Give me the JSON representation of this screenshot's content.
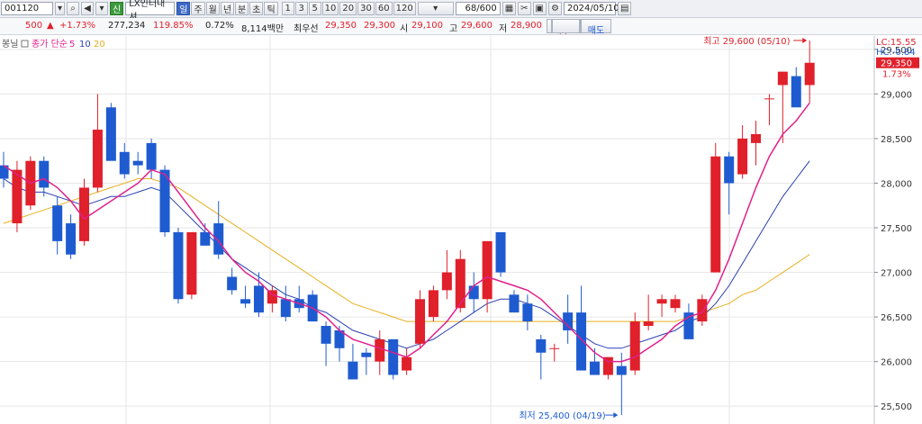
{
  "toolbar": {
    "code": "001120",
    "stock_name": "LX인터내셔",
    "period_tabs": [
      "일",
      "주",
      "월",
      "년",
      "분",
      "초",
      "틱"
    ],
    "active_tab": "일",
    "minute_options": [
      "1",
      "3",
      "5",
      "10",
      "20",
      "30",
      "60",
      "120"
    ],
    "count": "68",
    "count_total": "/600",
    "date": "2024/05/10",
    "badge": "신"
  },
  "info_bar": {
    "change": "500",
    "change_pct": "+1.73%",
    "volume": "277,234",
    "volume_ratio": "119.85%",
    "turnover": "0.72%",
    "amount": "8,114백만",
    "best_ask_label": "최우선",
    "best_ask": "29,350",
    "best_bid": "29,300",
    "open_label": "시",
    "open": "29,100",
    "high_label": "고",
    "high": "29,600",
    "low_label": "저",
    "low": "28,900",
    "buy_label": "매수",
    "sell_label": "매도"
  },
  "legend": {
    "prefix": "봉닐",
    "ma_label": "종가 단순",
    "ma_periods": [
      "5",
      "10",
      "20"
    ]
  },
  "colors": {
    "up": "#e0202a",
    "down": "#1f5bd0",
    "ma5": "#e0208c",
    "ma10": "#2a3fb0",
    "ma20": "#e8b020",
    "grid": "#e6e6e6"
  },
  "right_axis_labels": {
    "lc": "LC:15.55",
    "hc": "HC:-0.84",
    "last_price": "29,350",
    "last_pct": "1.73%"
  },
  "chart_data": {
    "type": "candlestick",
    "ylim": [
      25300,
      29650
    ],
    "y_ticks": [
      25500,
      26000,
      26500,
      27000,
      27500,
      28000,
      28500,
      29000,
      29500
    ],
    "y_tick_labels": [
      "25,500",
      "26,000",
      "26,500",
      "27,000",
      "27,500",
      "28,000",
      "28,500",
      "29,000",
      "29,500"
    ],
    "annotations": [
      {
        "text": "최고 29,600 (05/10)",
        "value": 29600
      },
      {
        "text": "최저 25,400 (04/19)",
        "value": 25400
      }
    ],
    "candles": [
      [
        28200,
        28350,
        27950,
        28050
      ],
      [
        27550,
        28250,
        27450,
        28150
      ],
      [
        27750,
        28300,
        27700,
        28250
      ],
      [
        28250,
        28300,
        27850,
        27950
      ],
      [
        27750,
        27850,
        27200,
        27350
      ],
      [
        27550,
        27650,
        27150,
        27200
      ],
      [
        27350,
        28050,
        27300,
        27950
      ],
      [
        27950,
        29000,
        27900,
        28600
      ],
      [
        28850,
        28900,
        28300,
        28250
      ],
      [
        28350,
        28450,
        28050,
        28100
      ],
      [
        28250,
        28350,
        28100,
        28200
      ],
      [
        28450,
        28500,
        28050,
        28150
      ],
      [
        28150,
        28200,
        27400,
        27450
      ],
      [
        27450,
        27500,
        26650,
        26700
      ],
      [
        26750,
        27450,
        26700,
        27450
      ],
      [
        27450,
        27550,
        27300,
        27300
      ],
      [
        27550,
        27800,
        27150,
        27200
      ],
      [
        26950,
        27050,
        26750,
        26800
      ],
      [
        26700,
        26850,
        26600,
        26650
      ],
      [
        26850,
        27000,
        26500,
        26550
      ],
      [
        26650,
        26850,
        26550,
        26800
      ],
      [
        26700,
        26850,
        26450,
        26500
      ],
      [
        26700,
        26850,
        26550,
        26600
      ],
      [
        26750,
        26800,
        26450,
        26450
      ],
      [
        26400,
        26450,
        25950,
        26200
      ],
      [
        26350,
        26400,
        26000,
        26150
      ],
      [
        26000,
        26200,
        25800,
        25800
      ],
      [
        26100,
        26150,
        25850,
        26050
      ],
      [
        26000,
        26350,
        25850,
        26250
      ],
      [
        26250,
        26250,
        25800,
        25850
      ],
      [
        25900,
        26150,
        25850,
        26050
      ],
      [
        26200,
        26800,
        26150,
        26700
      ],
      [
        26500,
        26850,
        26450,
        26800
      ],
      [
        26800,
        27250,
        26700,
        27000
      ],
      [
        26600,
        27250,
        26550,
        27150
      ],
      [
        26850,
        27000,
        26550,
        26700
      ],
      [
        26700,
        27350,
        26550,
        27350
      ],
      [
        27450,
        27450,
        26950,
        27000
      ],
      [
        26750,
        26800,
        26550,
        26550
      ],
      [
        26650,
        26750,
        26350,
        26450
      ],
      [
        26250,
        26300,
        25800,
        26100
      ],
      [
        26150,
        26200,
        26000,
        26150
      ],
      [
        26550,
        26750,
        26200,
        26350
      ],
      [
        26550,
        26850,
        25900,
        25900
      ],
      [
        26000,
        26150,
        25900,
        25850
      ],
      [
        25850,
        26050,
        25800,
        26050
      ],
      [
        25950,
        26100,
        25400,
        25850
      ],
      [
        25900,
        26550,
        25850,
        26450
      ],
      [
        26400,
        26750,
        26350,
        26450
      ],
      [
        26650,
        26750,
        26500,
        26700
      ],
      [
        26600,
        26750,
        26550,
        26700
      ],
      [
        26550,
        26650,
        26300,
        26250
      ],
      [
        26450,
        26750,
        26400,
        26700
      ],
      [
        27000,
        28450,
        27000,
        28300
      ],
      [
        28300,
        28350,
        27650,
        28000
      ],
      [
        28100,
        28650,
        28050,
        28500
      ],
      [
        28450,
        28700,
        28200,
        28550
      ],
      [
        28950,
        29000,
        28650,
        28950
      ],
      [
        29100,
        29250,
        28450,
        29250
      ],
      [
        29200,
        29300,
        28900,
        28850
      ],
      [
        29100,
        29600,
        28900,
        29350
      ]
    ],
    "ma5": [
      28200,
      28100,
      28000,
      28050,
      27950,
      27800,
      27600,
      27700,
      27800,
      27900,
      28000,
      28150,
      28100,
      27900,
      27700,
      27500,
      27350,
      27150,
      27000,
      26900,
      26750,
      26700,
      26650,
      26600,
      26500,
      26350,
      26250,
      26200,
      26150,
      26100,
      26050,
      26150,
      26300,
      26450,
      26650,
      26850,
      26950,
      26900,
      26850,
      26800,
      26700,
      26550,
      26400,
      26250,
      26100,
      26000,
      26000,
      26050,
      26150,
      26250,
      26400,
      26500,
      26550,
      26800,
      27150,
      27550,
      27950,
      28300,
      28550,
      28700,
      28900
    ],
    "ma10": [
      28050,
      27950,
      27900,
      27900,
      27850,
      27800,
      27750,
      27800,
      27850,
      27850,
      27900,
      27950,
      27900,
      27750,
      27600,
      27450,
      27300,
      27150,
      27050,
      26950,
      26850,
      26750,
      26700,
      26600,
      26550,
      26450,
      26350,
      26300,
      26250,
      26200,
      26150,
      26200,
      26250,
      26350,
      26450,
      26550,
      26650,
      26700,
      26700,
      26650,
      26600,
      26500,
      26400,
      26300,
      26200,
      26150,
      26150,
      26200,
      26250,
      26300,
      26350,
      26450,
      26500,
      26650,
      26850,
      27100,
      27350,
      27600,
      27850,
      28050,
      28250
    ],
    "ma20": [
      27550,
      27600,
      27650,
      27700,
      27750,
      27800,
      27850,
      27900,
      27950,
      28000,
      28050,
      28050,
      28000,
      27950,
      27850,
      27750,
      27650,
      27550,
      27450,
      27350,
      27250,
      27150,
      27050,
      26950,
      26850,
      26750,
      26650,
      26600,
      26550,
      26500,
      26450,
      26450,
      26450,
      26450,
      26450,
      26450,
      26450,
      26450,
      26450,
      26450,
      26450,
      26450,
      26450,
      26450,
      26450,
      26450,
      26450,
      26450,
      26450,
      26450,
      26450,
      26500,
      26550,
      26600,
      26650,
      26750,
      26800,
      26900,
      27000,
      27100,
      27200
    ]
  }
}
